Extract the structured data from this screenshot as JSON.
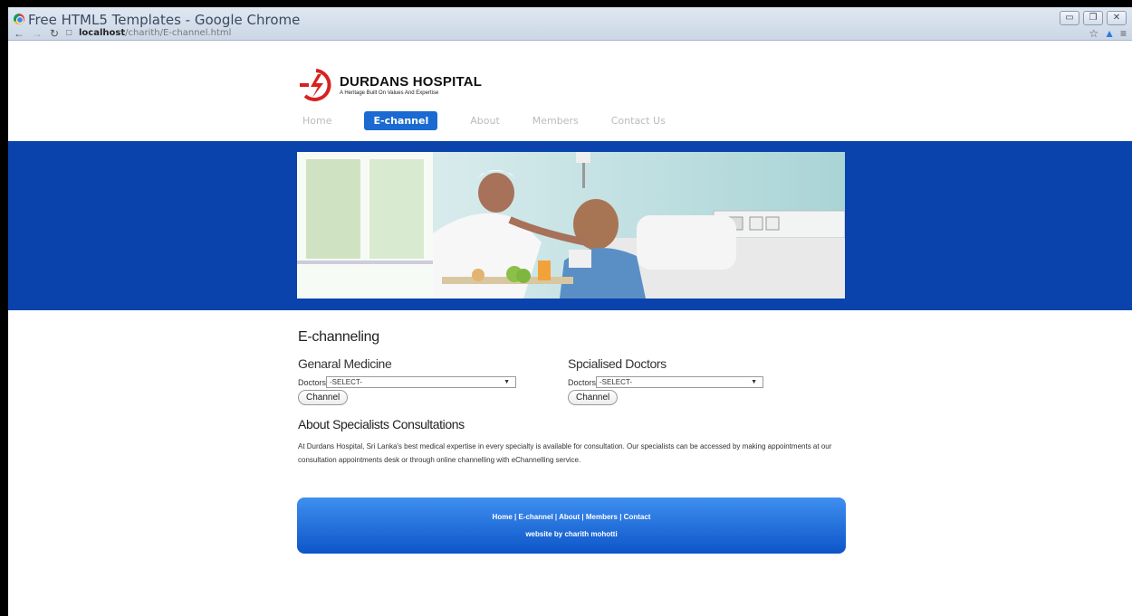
{
  "browser": {
    "title": "Free HTML5 Templates - Google Chrome",
    "url_host": "localhost",
    "url_path": "/charith/E-channel.html"
  },
  "site": {
    "name": "DURDANS HOSPITAL",
    "tagline": "A Heritage Built On Values And Expertise"
  },
  "nav": {
    "home": "Home",
    "echannel": "E-channel",
    "about": "About",
    "members": "Members",
    "contact": "Contact Us"
  },
  "main": {
    "heading": "E-channeling",
    "general": {
      "title": "Genaral Medicine",
      "label": "Doctors",
      "select": "-SELECT-",
      "button": "Channel"
    },
    "specialised": {
      "title": "Spcialised Doctors",
      "label": "Doctors",
      "select": "-SELECT-",
      "button": "Channel"
    },
    "about_title": "About Specialists Consultations",
    "about_text": "At Durdans Hospital, Sri Lanka's best medical expertise in every specialty is available for consultation. Our specialists can be accessed by making appointments at our consultation appointments desk or through online channelling with eChannelling service."
  },
  "footer": {
    "links": "Home | E-channel | About | Members | Contact",
    "credit": "website by charith mohotti"
  },
  "colors": {
    "band": "#0b43ad",
    "active_nav": "#1a6ad1",
    "footer_top": "#3f8ff0",
    "footer_bottom": "#0d55c8"
  }
}
